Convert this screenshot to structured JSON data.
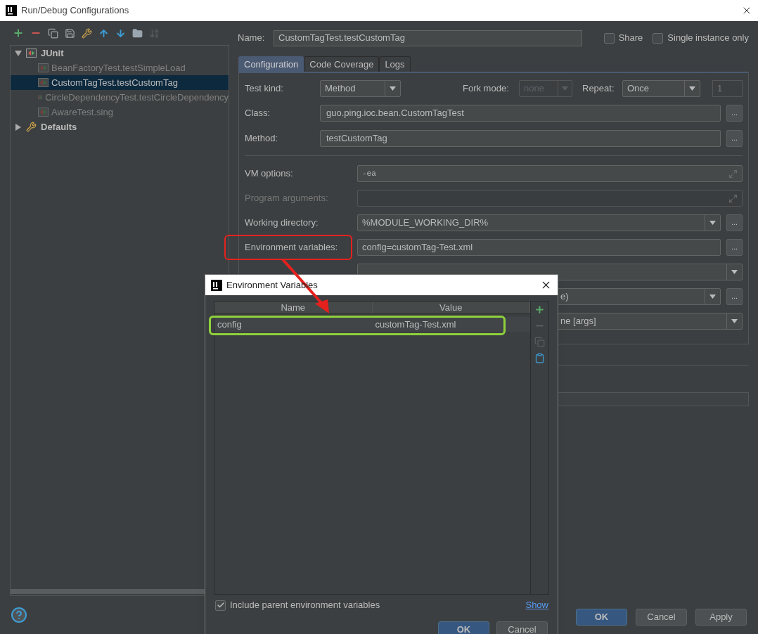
{
  "window": {
    "title": "Run/Debug Configurations"
  },
  "tree": [
    {
      "label": "JUnit",
      "kind": "group",
      "expanded": true,
      "selected": false,
      "children": [
        {
          "label": "BeanFactoryTest.testSimpleLoad",
          "selected": false
        },
        {
          "label": "CustomTagTest.testCustomTag",
          "selected": true
        },
        {
          "label": "CircleDependencyTest.testCircleDependency",
          "selected": false
        },
        {
          "label": "AwareTest.sing",
          "selected": false
        }
      ]
    },
    {
      "label": "Defaults",
      "kind": "defaults",
      "expanded": false,
      "selected": false
    }
  ],
  "name_field": {
    "label": "Name:",
    "value": "CustomTagTest.testCustomTag"
  },
  "options": [
    {
      "label": "Share",
      "checked": false
    },
    {
      "label": "Single instance only",
      "checked": false
    }
  ],
  "tabs": [
    {
      "label": "Configuration",
      "selected": true
    },
    {
      "label": "Code Coverage",
      "selected": false
    },
    {
      "label": "Logs",
      "selected": false
    }
  ],
  "test_row": {
    "test_kind": {
      "label": "Test kind:",
      "value": "Method"
    },
    "fork_mode": {
      "label": "Fork mode:",
      "value": "none",
      "disabled": true
    },
    "repeat": {
      "label": "Repeat:",
      "value": "Once"
    },
    "count": {
      "value": "1",
      "disabled": true
    }
  },
  "class_rows": [
    {
      "label": "Class:",
      "value": "guo.ping.ioc.bean.CustomTagTest",
      "button": "..."
    },
    {
      "label": "Method:",
      "value": "testCustomTag",
      "button": "..."
    }
  ],
  "run_rows": [
    {
      "kind": "expand",
      "label": "VM options:",
      "value": "-ea",
      "disabled": false
    },
    {
      "kind": "expand",
      "label": "Program arguments:",
      "disabled": true
    },
    {
      "kind": "combo",
      "label": "Working directory:",
      "value": "%MODULE_WORKING_DIR%",
      "button": "..."
    },
    {
      "kind": "text",
      "label": "Environment variables:",
      "value": "config=customTag-Test.xml",
      "button": "..."
    },
    {
      "kind": "combo"
    },
    {
      "kind": "combo",
      "value": "e)",
      "button": "..."
    },
    {
      "kind": "combo",
      "value": "ne [args]"
    }
  ],
  "buttons": [
    {
      "label": "OK",
      "primary": true
    },
    {
      "label": "Cancel",
      "primary": false
    },
    {
      "label": "Apply",
      "primary": false
    }
  ],
  "dialog": {
    "title": "Environment Variables",
    "columns": [
      "Name",
      "Value"
    ],
    "rows": [
      {
        "name": "config",
        "value": "customTag-Test.xml"
      }
    ],
    "tools": [
      {
        "kind": "add",
        "disabled": false
      },
      {
        "kind": "remove",
        "disabled": true
      },
      {
        "kind": "copy",
        "disabled": true
      },
      {
        "kind": "paste",
        "disabled": false
      }
    ],
    "include_parent": {
      "label": "Include parent environment variables",
      "checked": true
    },
    "link": "Show",
    "buttons": [
      {
        "label": "OK",
        "primary": true
      },
      {
        "label": "Cancel",
        "primary": false
      }
    ]
  }
}
